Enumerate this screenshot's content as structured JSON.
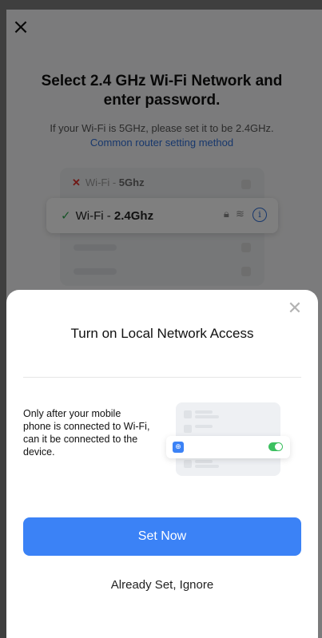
{
  "background_page": {
    "close_icon": "close-icon",
    "title": "Select 2.4 GHz Wi-Fi Network and enter password.",
    "subtitle": "If your Wi-Fi is 5GHz, please set it to be 2.4GHz.",
    "help_link": "Common router setting method",
    "wifi_illustration": {
      "bad_network": {
        "prefix": "Wi-Fi - ",
        "band": "5Ghz",
        "icon": "x-mark-icon"
      },
      "good_network": {
        "prefix": "Wi-Fi - ",
        "band": "2.4Ghz",
        "icon": "checkmark-icon",
        "status_icons": [
          "lock-icon",
          "wifi-signal-icon",
          "info-icon"
        ]
      }
    }
  },
  "sheet": {
    "close_icon": "close-icon",
    "title": "Turn on Local Network Access",
    "description": "Only after your mobile phone is connected to Wi-Fi, can it be connected to the device.",
    "illustration": {
      "toggle_state": "on",
      "app_icon": "globe-icon"
    },
    "primary_button": "Set Now",
    "secondary_button": "Already Set, Ignore"
  },
  "colors": {
    "accent": "#3b82f6",
    "link": "#2f6fd8",
    "success": "#2fa84f",
    "error": "#e0302a",
    "toggle_on": "#3cc060"
  }
}
